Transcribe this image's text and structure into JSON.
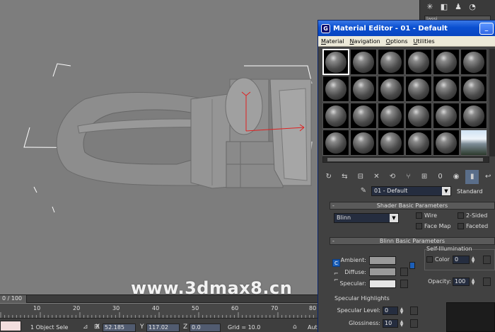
{
  "viewport": {
    "watermark": "www.3dmax8.cn"
  },
  "command_panel": {
    "field_text": "lassi"
  },
  "material_editor": {
    "title": "Material Editor - 01 - Default",
    "menu": [
      "Material",
      "Navigation",
      "Options",
      "Utilities"
    ],
    "slots": {
      "rows": 4,
      "cols": 6,
      "active_slot": 1,
      "environment_slot": 24
    },
    "material_name": "01 - Default",
    "material_type": "Standard",
    "shader_basic": {
      "header": "Shader Basic Parameters",
      "shader": "Blinn",
      "options": {
        "wire": "Wire",
        "two_sided": "2-Sided",
        "face_map": "Face Map",
        "faceted": "Faceted"
      }
    },
    "blinn_basic": {
      "header": "Blinn Basic Parameters",
      "self_illum_title": "Self-Illumination",
      "color_label": "Color",
      "color_value": "0",
      "ambient_label": "Ambient:",
      "diffuse_label": "Diffuse:",
      "specular_label": "Specular:",
      "opacity_label": "Opacity:",
      "opacity_value": "100",
      "ambient_color": "#9a9a9a",
      "diffuse_color": "#9a9a9a",
      "specular_color": "#e6e6e6"
    },
    "specular_highlights": {
      "title": "Specular Highlights",
      "level_label": "Specular Level:",
      "level_value": "0",
      "glossiness_label": "Glossiness:",
      "glossiness_value": "10"
    }
  },
  "timeline": {
    "frame_range": "0 / 100",
    "ticks": [
      "10",
      "20",
      "30",
      "40",
      "50",
      "60",
      "70",
      "80"
    ]
  },
  "status_bar": {
    "selection": "1 Object Sele",
    "x_label": "X",
    "x_value": "52.185",
    "y_label": "Y",
    "y_value": "117.02",
    "z_label": "Z",
    "z_value": "0.0",
    "grid": "Grid = 10.0",
    "auto": "Aut"
  }
}
